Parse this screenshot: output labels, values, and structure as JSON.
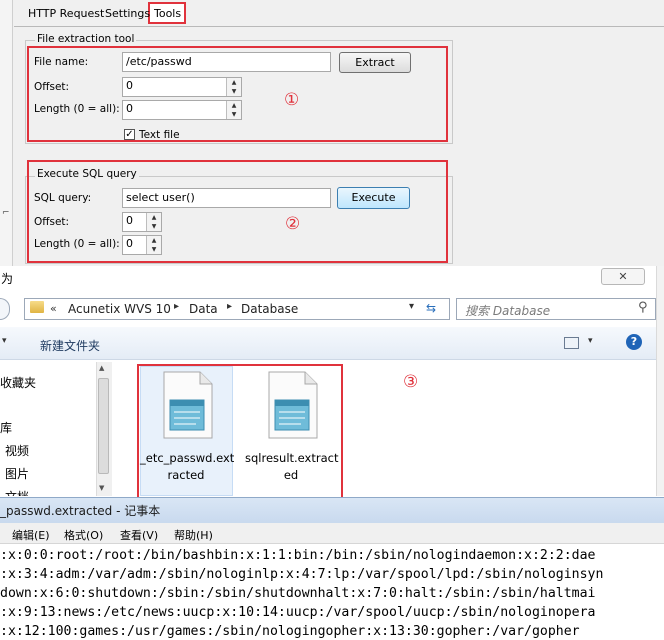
{
  "tabs": [
    "HTTP Request",
    "Settings",
    "Tools"
  ],
  "file_extraction": {
    "group_title": "File extraction tool",
    "file_name_label": "File name:",
    "file_name_value": "/etc/passwd",
    "offset_label": "Offset:",
    "offset_value": "0",
    "length_label": "Length (0 = all):",
    "length_value": "0",
    "extract_button": "Extract",
    "text_file_label": "Text file",
    "text_file_checked": true,
    "marker": "①"
  },
  "sql_query": {
    "group_title": "Execute SQL query",
    "sql_label": "SQL query:",
    "sql_value": "select user()",
    "offset_label": "Offset:",
    "offset_value": "0",
    "length_label": "Length (0 = all):",
    "length_value": "0",
    "execute_button": "Execute",
    "marker": "②"
  },
  "explorer": {
    "title_fragment": "为",
    "breadcrumb_chevron": "«",
    "breadcrumb": [
      "Acunetix WVS 10",
      "Data",
      "Database"
    ],
    "search_placeholder": "搜索 Database",
    "new_folder": "新建文件夹",
    "nav_items": [
      "收藏夹",
      "库",
      "视频",
      "图片",
      "文档"
    ],
    "files": [
      "_etc_passwd.extracted",
      "sqlresult.extracted"
    ],
    "file_lines": [
      [
        "_etc_passwd.ext",
        "racted"
      ],
      [
        "sqlresult.extract",
        "ed"
      ]
    ],
    "marker": "③"
  },
  "notepad": {
    "title": "_passwd.extracted - 记事本",
    "menu": [
      "编辑(E)",
      "格式(O)",
      "查看(V)",
      "帮助(H)"
    ],
    "lines": [
      ":x:0:0:root:/root:/bin/bashbin:x:1:1:bin:/bin:/sbin/nologindaemon:x:2:2:dae",
      ":x:3:4:adm:/var/adm:/sbin/nologinlp:x:4:7:lp:/var/spool/lpd:/sbin/nologinsyn",
      "down:x:6:0:shutdown:/sbin:/sbin/shutdownhalt:x:7:0:halt:/sbin:/sbin/haltmai",
      ":x:9:13:news:/etc/news:uucp:x:10:14:uucp:/var/spool/uucp:/sbin/nologinopera",
      ":x:12:100:games:/usr/games:/sbin/nologingopher:x:13:30:gopher:/var/gopher"
    ]
  }
}
